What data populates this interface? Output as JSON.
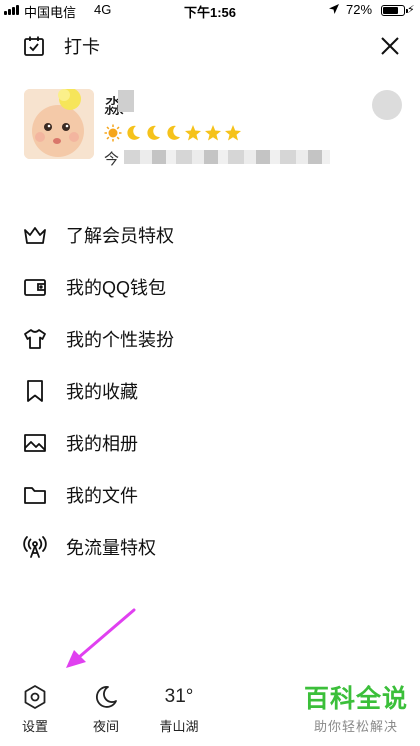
{
  "status_bar": {
    "carrier": "中国电信",
    "network": "4G",
    "time": "下午1:56",
    "battery": "72%",
    "battery_level": 0.72
  },
  "header": {
    "checkin_label": "打卡",
    "checkin_icon": "calendar-check-icon",
    "close_icon": "close-icon"
  },
  "profile": {
    "nickname_visible": "淼",
    "status_prefix": "今",
    "level_icons": [
      "sun-icon",
      "moon-icon",
      "moon-icon",
      "moon-icon",
      "star-icon",
      "star-icon",
      "star-icon"
    ]
  },
  "menu": {
    "items": [
      {
        "label": "了解会员特权",
        "icon": "crown-icon"
      },
      {
        "label": "我的QQ钱包",
        "icon": "wallet-icon"
      },
      {
        "label": "我的个性装扮",
        "icon": "tshirt-icon"
      },
      {
        "label": "我的收藏",
        "icon": "bookmark-icon"
      },
      {
        "label": "我的相册",
        "icon": "photo-album-icon"
      },
      {
        "label": "我的文件",
        "icon": "folder-icon"
      },
      {
        "label": "免流量特权",
        "icon": "signal-tower-icon"
      }
    ]
  },
  "toolbar": {
    "settings_label": "设置",
    "night_label": "夜间",
    "temperature": "31°",
    "city": "青山湖"
  },
  "watermark": {
    "main": "百科全说",
    "sub": "助你轻松解决"
  },
  "colors": {
    "watermark_green": "#3bbf3a",
    "arrow_magenta": "#e040f0",
    "star_gold": "#f5c21b"
  }
}
